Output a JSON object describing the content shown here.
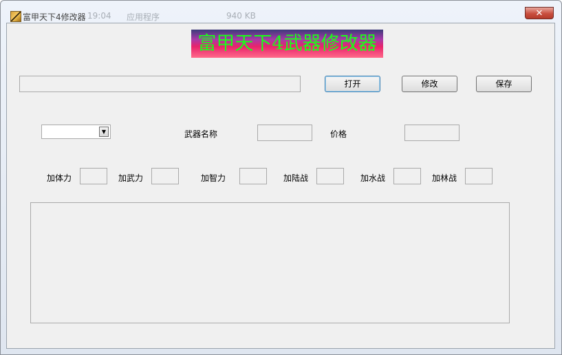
{
  "window": {
    "title": "富甲天下4修改器",
    "ghost_time": "19:04",
    "ghost_type": "应用程序",
    "ghost_size": "940 KB",
    "close_glyph": "✕"
  },
  "banner": {
    "text": "富甲天下4武器修改器",
    "text_color": "#19ff19"
  },
  "file_path": {
    "value": ""
  },
  "buttons": {
    "open": "打开",
    "modify": "修改",
    "save": "保存"
  },
  "weapon_select": {
    "selected": ""
  },
  "labels": {
    "weapon_name": "武器名称",
    "price": "价格",
    "add_physique": "加体力",
    "add_force": "加武力",
    "add_intellect": "加智力",
    "add_land_battle": "加陆战",
    "add_water_battle": "加水战",
    "add_forest_battle": "加林战"
  }
}
